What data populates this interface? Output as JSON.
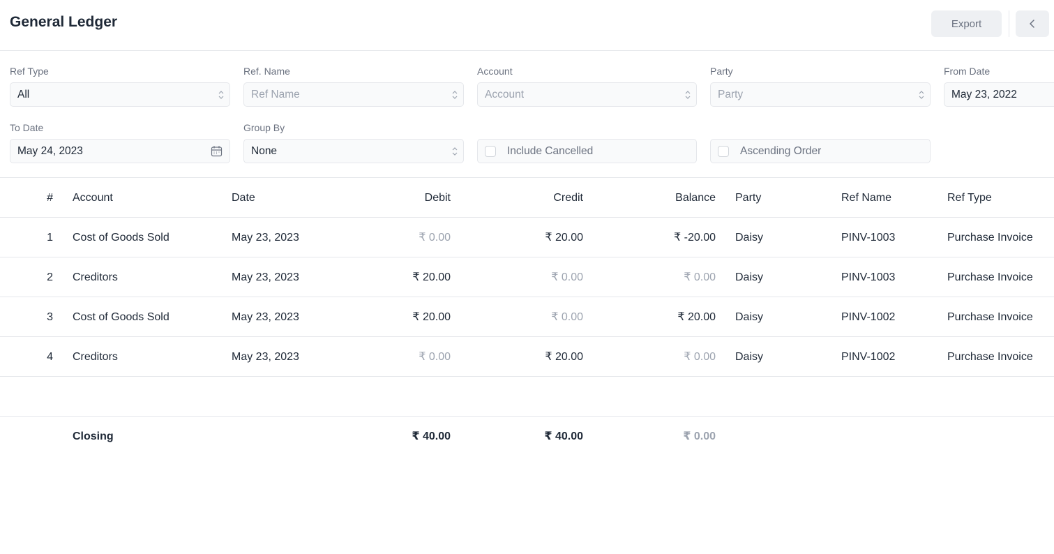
{
  "header": {
    "title": "General Ledger",
    "export_label": "Export"
  },
  "filters": {
    "ref_type": {
      "label": "Ref Type",
      "value": "All"
    },
    "ref_name": {
      "label": "Ref. Name",
      "placeholder": "Ref Name"
    },
    "account": {
      "label": "Account",
      "placeholder": "Account"
    },
    "party": {
      "label": "Party",
      "placeholder": "Party"
    },
    "from_date": {
      "label": "From Date",
      "value": "May 23, 2022"
    },
    "to_date": {
      "label": "To Date",
      "value": "May 24, 2023"
    },
    "group_by": {
      "label": "Group By",
      "value": "None"
    },
    "include_cancelled": {
      "label": "Include Cancelled",
      "checked": false
    },
    "ascending_order": {
      "label": "Ascending Order",
      "checked": false
    }
  },
  "table": {
    "columns": [
      "#",
      "Account",
      "Date",
      "Debit",
      "Credit",
      "Balance",
      "Party",
      "Ref Name",
      "Ref Type"
    ],
    "rows": [
      {
        "n": "1",
        "account": "Cost of Goods Sold",
        "date": "May 23, 2023",
        "debit": "₹ 0.00",
        "credit": "₹ 20.00",
        "balance": "₹ -20.00",
        "party": "Daisy",
        "ref_name": "PINV-1003",
        "ref_type": "Purchase Invoice"
      },
      {
        "n": "2",
        "account": "Creditors",
        "date": "May 23, 2023",
        "debit": "₹ 20.00",
        "credit": "₹ 0.00",
        "balance": "₹ 0.00",
        "party": "Daisy",
        "ref_name": "PINV-1003",
        "ref_type": "Purchase Invoice"
      },
      {
        "n": "3",
        "account": "Cost of Goods Sold",
        "date": "May 23, 2023",
        "debit": "₹ 20.00",
        "credit": "₹ 0.00",
        "balance": "₹ 20.00",
        "party": "Daisy",
        "ref_name": "PINV-1002",
        "ref_type": "Purchase Invoice"
      },
      {
        "n": "4",
        "account": "Creditors",
        "date": "May 23, 2023",
        "debit": "₹ 0.00",
        "credit": "₹ 20.00",
        "balance": "₹ 0.00",
        "party": "Daisy",
        "ref_name": "PINV-1002",
        "ref_type": "Purchase Invoice"
      }
    ],
    "closing": {
      "label": "Closing",
      "debit": "₹ 40.00",
      "credit": "₹ 40.00",
      "balance": "₹ 0.00"
    }
  },
  "colors": {
    "text": "#1f2937",
    "muted": "#9ca3af",
    "border": "#e5e7eb",
    "button_bg": "#eef0f3"
  }
}
